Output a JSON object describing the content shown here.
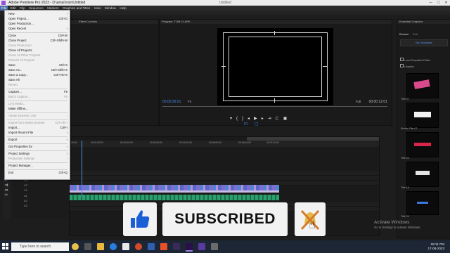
{
  "window": {
    "title": "Adobe Premiere Pro 2023 - D:\\amal tram\\Untitled",
    "doc_name": "Untitled",
    "controls": [
      "—",
      "☐",
      "✕"
    ]
  },
  "menubar": [
    "File",
    "Edit",
    "Clip",
    "Sequence",
    "Markers",
    "Graphics and Titles",
    "View",
    "Window",
    "Help"
  ],
  "file_menu": [
    {
      "label": "New",
      "shortcut": "",
      "arrow": true,
      "disabled": false,
      "sep_after": false
    },
    {
      "label": "Open Project...",
      "shortcut": "Ctrl+O",
      "disabled": false,
      "sep_after": false
    },
    {
      "label": "Open Production...",
      "shortcut": "",
      "disabled": false,
      "sep_after": false
    },
    {
      "label": "Open Recent",
      "shortcut": "",
      "arrow": true,
      "disabled": false,
      "sep_after": true
    },
    {
      "label": "Close",
      "shortcut": "Ctrl+W",
      "disabled": false,
      "sep_after": false
    },
    {
      "label": "Close Project",
      "shortcut": "Ctrl+Shift+W",
      "disabled": false,
      "sep_after": false
    },
    {
      "label": "Close Production",
      "shortcut": "",
      "disabled": true,
      "sep_after": false
    },
    {
      "label": "Close All Projects",
      "shortcut": "",
      "disabled": false,
      "sep_after": false
    },
    {
      "label": "Close All Other Projects",
      "shortcut": "",
      "disabled": true,
      "sep_after": false
    },
    {
      "label": "Refresh All Projects",
      "shortcut": "",
      "disabled": true,
      "sep_after": false
    },
    {
      "label": "Save",
      "shortcut": "Ctrl+S",
      "disabled": false,
      "sep_after": false
    },
    {
      "label": "Save As...",
      "shortcut": "Ctrl+Shift+S",
      "disabled": false,
      "sep_after": false
    },
    {
      "label": "Save a Copy...",
      "shortcut": "Ctrl+Alt+S",
      "disabled": false,
      "sep_after": false
    },
    {
      "label": "Save All",
      "shortcut": "",
      "disabled": false,
      "sep_after": false
    },
    {
      "label": "Revert",
      "shortcut": "",
      "disabled": true,
      "sep_after": true
    },
    {
      "label": "Capture...",
      "shortcut": "F5",
      "disabled": false,
      "sep_after": false
    },
    {
      "label": "Batch Capture...",
      "shortcut": "F6",
      "disabled": true,
      "sep_after": true
    },
    {
      "label": "Link Media...",
      "shortcut": "",
      "disabled": true,
      "sep_after": false
    },
    {
      "label": "Make Offline...",
      "shortcut": "",
      "disabled": false,
      "sep_after": true
    },
    {
      "label": "Adobe Dynamic Link",
      "shortcut": "",
      "arrow": true,
      "disabled": true,
      "sep_after": true
    },
    {
      "label": "Import from Media Browser",
      "shortcut": "Ctrl+Alt+I",
      "disabled": true,
      "sep_after": false
    },
    {
      "label": "Import...",
      "shortcut": "Ctrl+I",
      "disabled": false,
      "sep_after": false
    },
    {
      "label": "Import Recent File",
      "shortcut": "",
      "arrow": true,
      "disabled": false,
      "sep_after": true
    },
    {
      "label": "Export",
      "shortcut": "",
      "arrow": true,
      "disabled": false,
      "sep_after": true
    },
    {
      "label": "Get Properties for",
      "shortcut": "",
      "arrow": true,
      "disabled": false,
      "sep_after": true
    },
    {
      "label": "Project Settings",
      "shortcut": "",
      "arrow": true,
      "disabled": false,
      "sep_after": false
    },
    {
      "label": "Production Settings",
      "shortcut": "",
      "arrow": true,
      "disabled": true,
      "sep_after": true
    },
    {
      "label": "Project Manager...",
      "shortcut": "",
      "disabled": false,
      "sep_after": true
    },
    {
      "label": "Exit",
      "shortcut": "Ctrl+Q",
      "disabled": false,
      "sep_after": false
    }
  ],
  "panels": {
    "effect_controls": "Effect Controls",
    "program_label": "Program: TOM CLARK",
    "essential_graphics": "Essential Graphics",
    "browse_tab": "Browse",
    "edit_tab": "Edit",
    "my_templates": "My Templates",
    "local_templates": "Local Templates Folder",
    "libraries": "Libraries"
  },
  "program": {
    "timecode_left": "00:00:29:01",
    "timecode_right": "00:00:12:01",
    "fit": "Fit",
    "full": "Full"
  },
  "timeline": {
    "ruler_ticks": [
      "00:00",
      "00:01:00:00",
      "00:02:00:00",
      "00:03:00:00",
      "00:04:00:00",
      "00:05:00:00",
      "00:06:00:00",
      "00:07:00:00"
    ],
    "tracks": [
      "V3",
      "V2",
      "V1",
      "A1",
      "A2",
      "A3"
    ]
  },
  "graphics_titles": [
    "Title 07",
    "Kinetic Title 07",
    "Title 24",
    "Title 18",
    "Title 24"
  ],
  "overlay": {
    "subscribed": "SUBSCRIBED"
  },
  "activation": {
    "line1": "Activate Windows",
    "line2": "Go to Settings to activate Windows."
  },
  "taskbar": {
    "search": "Type here to search",
    "time": "08:11 PM",
    "date": "17-08-2023"
  },
  "colors": {
    "accent": "#4c8ff0",
    "like": "#1a5fd6",
    "menu_highlight": "#4a6ea8"
  }
}
